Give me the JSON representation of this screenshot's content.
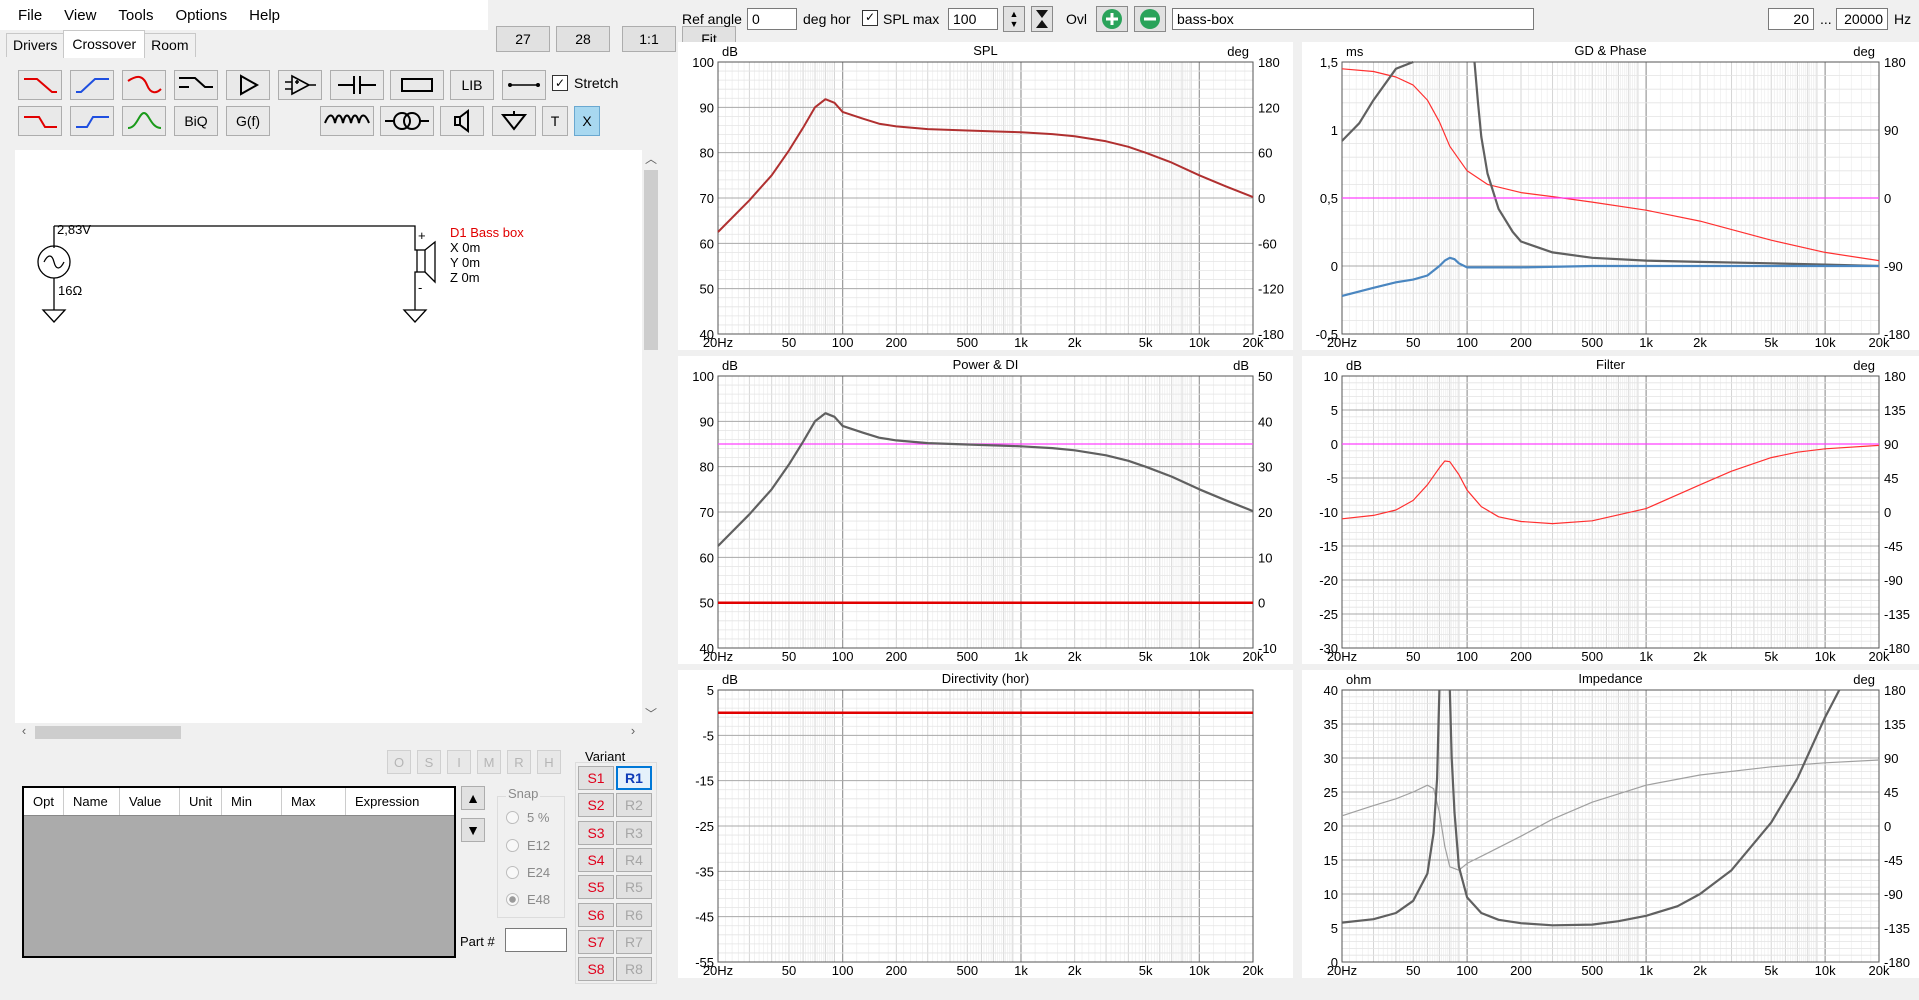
{
  "menu": [
    "File",
    "View",
    "Tools",
    "Options",
    "Help"
  ],
  "tabs": [
    {
      "label": "Drivers",
      "active": false
    },
    {
      "label": "Crossover",
      "active": true
    },
    {
      "label": "Room",
      "active": false
    }
  ],
  "zoom_buttons": [
    "27",
    "28",
    "1:1",
    "Fit"
  ],
  "toolbar": {
    "lib": "LIB",
    "stretch": "Stretch",
    "biq": "BiQ",
    "gf": "G(f)",
    "t": "T",
    "x": "X"
  },
  "schematic": {
    "voltage": "2,83V",
    "resistance": "16Ω",
    "driver_name": "D1 Bass box",
    "driver_x": "X 0m",
    "driver_y": "Y 0m",
    "driver_z": "Z 0m",
    "plus": "+",
    "minus": "-"
  },
  "opt_buttons": [
    "O",
    "S",
    "I",
    "M",
    "R",
    "H"
  ],
  "opt_table_headers": [
    "Opt",
    "Name",
    "Value",
    "Unit",
    "Min",
    "Max",
    "Expression"
  ],
  "snap": {
    "label": "Snap",
    "options": [
      "5 %",
      "E12",
      "E24",
      "E48"
    ],
    "selected": "E48"
  },
  "part_label": "Part #",
  "variant": {
    "label": "Variant",
    "s": [
      "S1",
      "S2",
      "S3",
      "S4",
      "S5",
      "S6",
      "S7",
      "S8"
    ],
    "r": [
      "R1",
      "R2",
      "R3",
      "R4",
      "R5",
      "R6",
      "R7",
      "R8"
    ],
    "selected": "R1"
  },
  "topbar": {
    "ref_angle_label": "Ref angle",
    "ref_angle_value": "0",
    "deg_hor": "deg hor",
    "spl_max_label": "SPL max",
    "spl_max_value": "100",
    "ovl": "Ovl",
    "project": "bass-box",
    "f_min": "20",
    "ellipsis": "...",
    "f_max": "20000",
    "hz": "Hz"
  },
  "colors": {
    "red": "#e10000",
    "darkred": "#b03030",
    "gray": "#606060",
    "blue": "#4a86c0",
    "magenta": "#ff40ff",
    "grid": "#c8c8c8",
    "lightred": "#ff5050",
    "lightgray": "#a0a0a0"
  },
  "chart_data": [
    {
      "id": "spl",
      "type": "line",
      "title": "SPL",
      "ylabel": "dB",
      "y2label": "deg",
      "x_ticks": [
        "20Hz",
        "50",
        "100",
        "200",
        "500",
        "1k",
        "2k",
        "5k",
        "10k",
        "20k"
      ],
      "ylim": [
        40,
        100
      ],
      "y_ticks": [
        "100",
        "90",
        "80",
        "70",
        "60",
        "50",
        "40"
      ],
      "y2lim": [
        -180,
        180
      ],
      "y2_ticks": [
        "180",
        "120",
        "60",
        "0",
        "-60",
        "-120",
        "-180"
      ],
      "series": [
        {
          "color": "#b03030",
          "width": 2,
          "x": [
            20,
            30,
            40,
            50,
            60,
            70,
            80,
            90,
            100,
            130,
            160,
            200,
            300,
            500,
            700,
            1000,
            1500,
            2000,
            3000,
            4000,
            5000,
            7000,
            10000,
            14000,
            20000
          ],
          "y": [
            62.5,
            69.5,
            75,
            80.5,
            85.5,
            90,
            91.8,
            91,
            89,
            87.5,
            86.4,
            85.8,
            85.2,
            84.9,
            84.7,
            84.5,
            84.1,
            83.6,
            82.5,
            81.3,
            80,
            77.8,
            75,
            72.6,
            70.2
          ]
        }
      ]
    },
    {
      "id": "gd",
      "type": "line",
      "title": "GD & Phase",
      "ylabel": "ms",
      "y2label": "deg",
      "x_ticks": [
        "20Hz",
        "50",
        "100",
        "200",
        "500",
        "1k",
        "2k",
        "5k",
        "10k",
        "20k"
      ],
      "ylim": [
        -0.5,
        1.5
      ],
      "y_ticks": [
        "1,5",
        "1",
        "0,5",
        "0",
        "-0,5"
      ],
      "y2lim": [
        -180,
        180
      ],
      "y2_ticks": [
        "180",
        "90",
        "0",
        "-90",
        "-180"
      ],
      "series": [
        {
          "color": "#ff3030",
          "width": 1.2,
          "x": [
            20,
            30,
            40,
            50,
            60,
            70,
            80,
            100,
            130,
            200,
            300,
            500,
            1000,
            2000,
            5000,
            10000,
            20000
          ],
          "y": [
            1.45,
            1.43,
            1.39,
            1.33,
            1.22,
            1.06,
            0.88,
            0.7,
            0.6,
            0.54,
            0.51,
            0.47,
            0.41,
            0.33,
            0.19,
            0.1,
            0.04
          ]
        },
        {
          "color": "#606060",
          "width": 2.2,
          "x": [
            20,
            25,
            30,
            40,
            50
          ],
          "y": [
            0.92,
            1.05,
            1.22,
            1.45,
            1.6
          ]
        },
        {
          "color": "#606060",
          "width": 2.2,
          "x": [
            110,
            115,
            120,
            130,
            150,
            180,
            200,
            300,
            500,
            1000,
            2000,
            5000,
            10000,
            20000
          ],
          "y": [
            1.6,
            1.2,
            0.95,
            0.68,
            0.42,
            0.25,
            0.18,
            0.1,
            0.06,
            0.04,
            0.03,
            0.02,
            0.01,
            0.0
          ]
        },
        {
          "color": "#ff40ff",
          "width": 1.2,
          "x": [
            20,
            20000
          ],
          "y": [
            0.5,
            0.5
          ]
        },
        {
          "color": "#4a86c0",
          "width": 2.2,
          "x": [
            20,
            30,
            40,
            50,
            60,
            70,
            75,
            80,
            85,
            90,
            100,
            130,
            200,
            500,
            1000,
            5000,
            20000
          ],
          "y": [
            -0.22,
            -0.16,
            -0.12,
            -0.1,
            -0.07,
            0.0,
            0.04,
            0.06,
            0.05,
            0.02,
            -0.01,
            -0.01,
            -0.01,
            0.0,
            0.0,
            0.0,
            0.0
          ]
        }
      ]
    },
    {
      "id": "power",
      "type": "line",
      "title": "Power & DI",
      "ylabel": "dB",
      "y2label": "dB",
      "x_ticks": [
        "20Hz",
        "50",
        "100",
        "200",
        "500",
        "1k",
        "2k",
        "5k",
        "10k",
        "20k"
      ],
      "ylim": [
        40,
        100
      ],
      "y_ticks": [
        "100",
        "90",
        "80",
        "70",
        "60",
        "50",
        "40"
      ],
      "y2lim": [
        -10,
        50
      ],
      "y2_ticks": [
        "50",
        "40",
        "30",
        "20",
        "10",
        "0",
        "-10"
      ],
      "series": [
        {
          "color": "#ff40ff",
          "width": 1.2,
          "x": [
            20,
            20000
          ],
          "y": [
            85,
            85
          ]
        },
        {
          "color": "#606060",
          "width": 2.2,
          "x": [
            20,
            30,
            40,
            50,
            60,
            70,
            80,
            90,
            100,
            130,
            160,
            200,
            300,
            500,
            700,
            1000,
            1500,
            2000,
            3000,
            4000,
            5000,
            7000,
            10000,
            14000,
            20000
          ],
          "y": [
            62.5,
            69.5,
            75,
            80.5,
            85.5,
            90,
            91.8,
            91,
            89,
            87.5,
            86.4,
            85.8,
            85.2,
            84.9,
            84.7,
            84.5,
            84.1,
            83.6,
            82.5,
            81.3,
            80,
            77.8,
            75,
            72.6,
            70.2
          ]
        },
        {
          "color": "#e10000",
          "width": 2.5,
          "x": [
            20,
            20000
          ],
          "y": [
            50,
            50
          ]
        }
      ]
    },
    {
      "id": "filter",
      "type": "line",
      "title": "Filter",
      "ylabel": "dB",
      "y2label": "deg",
      "x_ticks": [
        "20Hz",
        "50",
        "100",
        "200",
        "500",
        "1k",
        "2k",
        "5k",
        "10k",
        "20k"
      ],
      "ylim": [
        -30,
        10
      ],
      "y_ticks": [
        "10",
        "5",
        "0",
        "-5",
        "-10",
        "-15",
        "-20",
        "-25",
        "-30"
      ],
      "y2lim": [
        -180,
        180
      ],
      "y2_ticks": [
        "180",
        "135",
        "90",
        "45",
        "0",
        "-45",
        "-90",
        "-135",
        "-180"
      ],
      "series": [
        {
          "color": "#ff40ff",
          "width": 1.2,
          "x": [
            20,
            20000
          ],
          "y": [
            0,
            0
          ]
        },
        {
          "color": "#ff3030",
          "width": 1.2,
          "x": [
            20,
            30,
            40,
            50,
            60,
            70,
            75,
            80,
            90,
            100,
            120,
            150,
            200,
            300,
            500,
            1000,
            2000,
            3000,
            5000,
            7000,
            10000,
            20000
          ],
          "y": [
            -11,
            -10.5,
            -9.7,
            -8.3,
            -6,
            -3.5,
            -2.5,
            -2.6,
            -4.5,
            -6.8,
            -9.2,
            -10.7,
            -11.4,
            -11.7,
            -11.3,
            -9.5,
            -6,
            -4,
            -2,
            -1.2,
            -0.7,
            -0.2
          ]
        }
      ]
    },
    {
      "id": "directivity",
      "type": "line",
      "title": "Directivity (hor)",
      "ylabel": "dB",
      "y2label": "",
      "x_ticks": [
        "20Hz",
        "50",
        "100",
        "200",
        "500",
        "1k",
        "2k",
        "5k",
        "10k",
        "20k"
      ],
      "ylim": [
        -55,
        5
      ],
      "y_ticks": [
        "5",
        "-5",
        "-15",
        "-25",
        "-35",
        "-45",
        "-55"
      ],
      "y2lim": null,
      "y2_ticks": [],
      "series": [
        {
          "color": "#e10000",
          "width": 2.5,
          "x": [
            20,
            20000
          ],
          "y": [
            0,
            0
          ]
        }
      ]
    },
    {
      "id": "impedance",
      "type": "line",
      "title": "Impedance",
      "ylabel": "ohm",
      "y2label": "deg",
      "x_ticks": [
        "20Hz",
        "50",
        "100",
        "200",
        "500",
        "1k",
        "2k",
        "5k",
        "10k",
        "20k"
      ],
      "ylim": [
        0,
        40
      ],
      "y_ticks": [
        "40",
        "35",
        "30",
        "25",
        "20",
        "15",
        "10",
        "5",
        "0"
      ],
      "y2lim": [
        -180,
        180
      ],
      "y2_ticks": [
        "180",
        "135",
        "90",
        "45",
        "0",
        "-45",
        "-90",
        "-135",
        "-180"
      ],
      "series": [
        {
          "color": "#a0a0a0",
          "width": 1.2,
          "x": [
            20,
            30,
            40,
            50,
            60,
            65,
            70,
            75,
            80,
            90,
            100,
            130,
            200,
            300,
            500,
            1000,
            2000,
            5000,
            10000,
            20000
          ],
          "y": [
            21.5,
            23,
            24,
            25,
            26,
            25.5,
            22,
            17,
            14,
            13.5,
            14.5,
            16,
            18.5,
            21,
            23.5,
            26,
            27.5,
            28.7,
            29.3,
            29.7
          ]
        },
        {
          "color": "#606060",
          "width": 2.2,
          "x": [
            20,
            30,
            40,
            50,
            60,
            65,
            68,
            70
          ],
          "y": [
            5.8,
            6.3,
            7.2,
            9,
            13,
            19,
            27,
            40
          ]
        },
        {
          "color": "#606060",
          "width": 2.2,
          "x": [
            80,
            82,
            85,
            90,
            100,
            120,
            150,
            200,
            300,
            500,
            700,
            1000,
            1500,
            2000,
            3000,
            5000,
            7000,
            10000,
            12000
          ],
          "y": [
            40,
            30,
            22,
            14,
            9.5,
            7.2,
            6.2,
            5.7,
            5.4,
            5.5,
            6,
            6.8,
            8.2,
            10,
            13.5,
            20.5,
            27,
            36,
            40
          ]
        }
      ]
    }
  ]
}
